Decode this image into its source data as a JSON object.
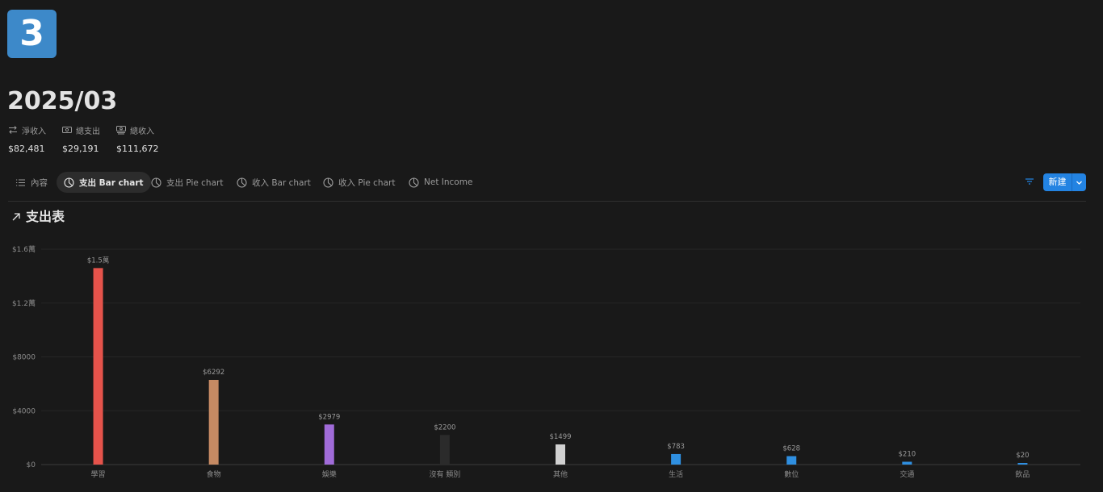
{
  "page": {
    "icon_text": "3",
    "title": "2025/03"
  },
  "properties": [
    {
      "name": "淨收入",
      "value": "$82,481",
      "icon": "arrows-swap-icon"
    },
    {
      "name": "總支出",
      "value": "$29,191",
      "icon": "money-icon"
    },
    {
      "name": "總收入",
      "value": "$111,672",
      "icon": "money-stack-icon"
    }
  ],
  "tabs": [
    {
      "label": "內容",
      "icon": "list-icon",
      "active": false
    },
    {
      "label": "支出 Bar chart",
      "icon": "chart-icon",
      "active": true
    },
    {
      "label": "支出 Pie chart",
      "icon": "chart-icon",
      "active": false
    },
    {
      "label": "收入 Bar chart",
      "icon": "chart-icon",
      "active": false
    },
    {
      "label": "收入 Pie chart",
      "icon": "chart-icon",
      "active": false
    },
    {
      "label": "Net Income",
      "icon": "chart-icon",
      "active": false
    }
  ],
  "toolbar": {
    "new_label": "新建"
  },
  "view": {
    "title": "支出表"
  },
  "chart_data": {
    "type": "bar",
    "title": "支出表",
    "categories": [
      "學習",
      "食物",
      "娛樂",
      "沒有 類別",
      "其他",
      "生活",
      "數位",
      "交通",
      "飲品"
    ],
    "values": [
      14600,
      6292,
      2979,
      2200,
      1499,
      783,
      628,
      210,
      20
    ],
    "data_labels": [
      "$1.5萬",
      "$6292",
      "$2979",
      "$2200",
      "$1499",
      "$783",
      "$628",
      "$210",
      "$20"
    ],
    "colors": [
      "#e5534b",
      "#c58a63",
      "#a06bd8",
      "#2b2b2b",
      "#d0d0d0",
      "#2f8fe0",
      "#2f8fe0",
      "#2f8fe0",
      "#2f8fe0"
    ],
    "ylim": [
      0,
      16000
    ],
    "yticks": [
      0,
      4000,
      8000,
      12000,
      16000
    ],
    "ytick_labels": [
      "$0",
      "$4000",
      "$8000",
      "$1.2萬",
      "$1.6萬"
    ],
    "grid": true,
    "legend": "none"
  }
}
